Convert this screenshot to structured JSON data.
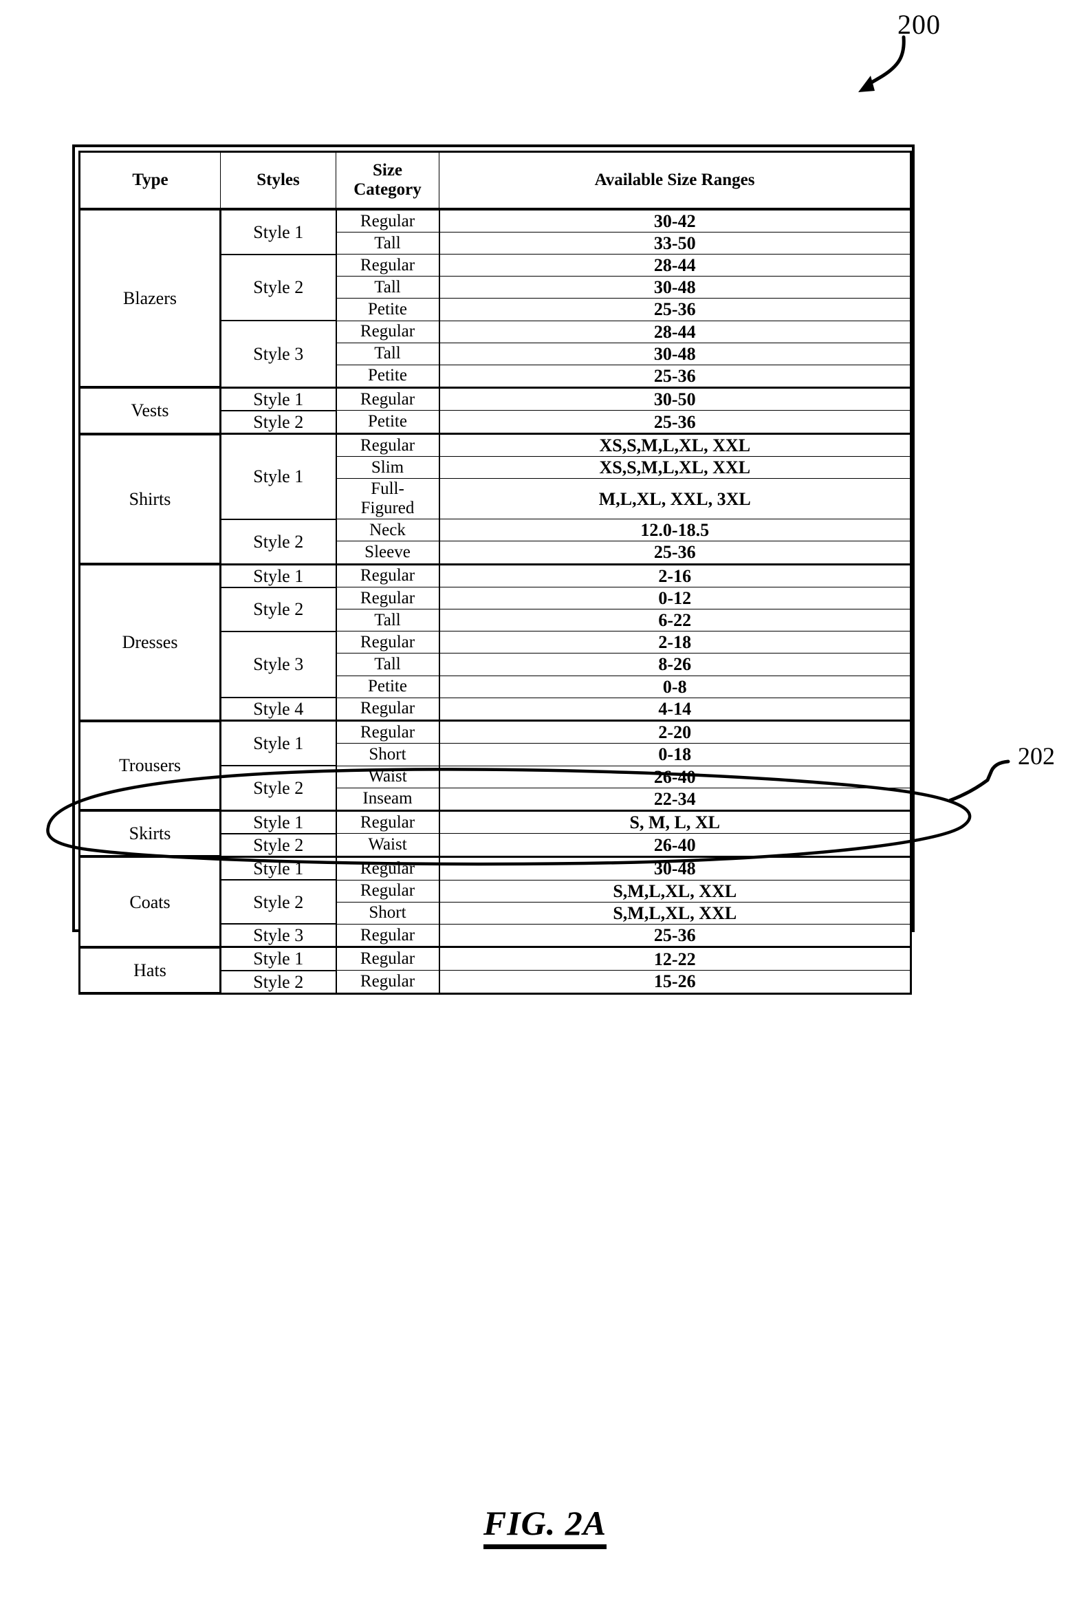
{
  "figure": {
    "reference_numeral": "200",
    "caption": "FIG. 2A",
    "annotation": {
      "numeral": "202",
      "marked_rows": [
        "Dresses Style 1 Regular 2-16",
        "Dresses Style 2 Regular 0-12",
        "Dresses Style 2 Tall 6-22"
      ]
    }
  },
  "table": {
    "headers": [
      "Type",
      "Styles",
      "Size Category",
      "Available Size Ranges"
    ],
    "header_lines": {
      "type": "Type",
      "styles": "Styles",
      "size_category_line1": "Size",
      "size_category_line2": "Category",
      "available_size_ranges": "Available Size Ranges"
    },
    "groups": [
      {
        "type": "Blazers",
        "styles": [
          {
            "name": "Style 1",
            "rows": [
              {
                "size_category": "Regular",
                "range": "30-42"
              },
              {
                "size_category": "Tall",
                "range": "33-50"
              }
            ]
          },
          {
            "name": "Style 2",
            "rows": [
              {
                "size_category": "Regular",
                "range": "28-44"
              },
              {
                "size_category": "Tall",
                "range": "30-48"
              },
              {
                "size_category": "Petite",
                "range": "25-36"
              }
            ]
          },
          {
            "name": "Style 3",
            "rows": [
              {
                "size_category": "Regular",
                "range": "28-44"
              },
              {
                "size_category": "Tall",
                "range": "30-48"
              },
              {
                "size_category": "Petite",
                "range": "25-36"
              }
            ]
          }
        ]
      },
      {
        "type": "Vests",
        "styles": [
          {
            "name": "Style 1",
            "rows": [
              {
                "size_category": "Regular",
                "range": "30-50"
              }
            ]
          },
          {
            "name": "Style 2",
            "rows": [
              {
                "size_category": "Petite",
                "range": "25-36"
              }
            ]
          }
        ]
      },
      {
        "type": "Shirts",
        "styles": [
          {
            "name": "Style 1",
            "rows": [
              {
                "size_category": "Regular",
                "range": "XS,S,M,L,XL, XXL"
              },
              {
                "size_category": "Slim",
                "range": "XS,S,M,L,XL, XXL"
              },
              {
                "size_category": "Full-Figured",
                "range": "M,L,XL, XXL, 3XL",
                "two_line": true,
                "line1": "Full-",
                "line2": "Figured"
              }
            ]
          },
          {
            "name": "Style 2",
            "rows": [
              {
                "size_category": "Neck",
                "range": "12.0-18.5"
              },
              {
                "size_category": "Sleeve",
                "range": "25-36"
              }
            ]
          }
        ]
      },
      {
        "type": "Dresses",
        "styles": [
          {
            "name": "Style 1",
            "rows": [
              {
                "size_category": "Regular",
                "range": "2-16"
              }
            ]
          },
          {
            "name": "Style 2",
            "rows": [
              {
                "size_category": "Regular",
                "range": "0-12"
              },
              {
                "size_category": "Tall",
                "range": "6-22"
              }
            ]
          },
          {
            "name": "Style 3",
            "rows": [
              {
                "size_category": "Regular",
                "range": "2-18"
              },
              {
                "size_category": "Tall",
                "range": "8-26"
              },
              {
                "size_category": "Petite",
                "range": "0-8"
              }
            ]
          },
          {
            "name": "Style 4",
            "rows": [
              {
                "size_category": "Regular",
                "range": "4-14"
              }
            ]
          }
        ]
      },
      {
        "type": "Trousers",
        "styles": [
          {
            "name": "Style 1",
            "rows": [
              {
                "size_category": "Regular",
                "range": "2-20"
              },
              {
                "size_category": "Short",
                "range": "0-18"
              }
            ]
          },
          {
            "name": "Style 2",
            "rows": [
              {
                "size_category": "Waist",
                "range": "26-40"
              },
              {
                "size_category": "Inseam",
                "range": "22-34"
              }
            ]
          }
        ]
      },
      {
        "type": "Skirts",
        "styles": [
          {
            "name": "Style 1",
            "rows": [
              {
                "size_category": "Regular",
                "range": "S, M, L, XL"
              }
            ]
          },
          {
            "name": "Style 2",
            "rows": [
              {
                "size_category": "Waist",
                "range": "26-40"
              }
            ]
          }
        ]
      },
      {
        "type": "Coats",
        "styles": [
          {
            "name": "Style 1",
            "rows": [
              {
                "size_category": "Regular",
                "range": "30-48"
              }
            ]
          },
          {
            "name": "Style 2",
            "rows": [
              {
                "size_category": "Regular",
                "range": "S,M,L,XL, XXL"
              },
              {
                "size_category": "Short",
                "range": "S,M,L,XL, XXL"
              }
            ]
          },
          {
            "name": "Style 3",
            "rows": [
              {
                "size_category": "Regular",
                "range": "25-36"
              }
            ]
          }
        ]
      },
      {
        "type": "Hats",
        "styles": [
          {
            "name": "Style 1",
            "rows": [
              {
                "size_category": "Regular",
                "range": "12-22"
              }
            ]
          },
          {
            "name": "Style 2",
            "rows": [
              {
                "size_category": "Regular",
                "range": "15-26"
              }
            ]
          }
        ]
      }
    ]
  }
}
